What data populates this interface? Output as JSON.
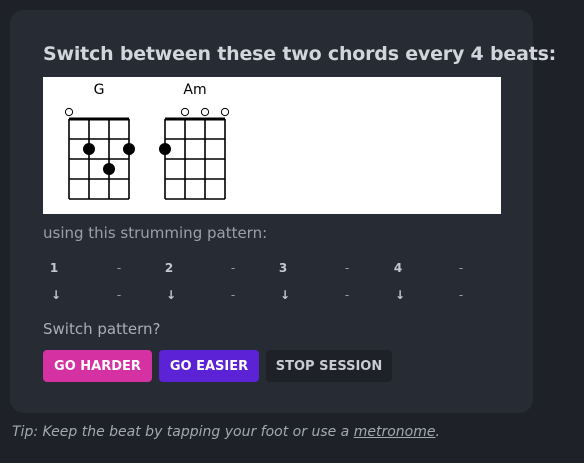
{
  "title": "Switch between these two chords every 4 beats:",
  "chords": [
    {
      "name": "G",
      "strings": [
        "o",
        "",
        "",
        ""
      ]
    },
    {
      "name": "Am",
      "strings": [
        "",
        "o",
        "o",
        "o"
      ]
    }
  ],
  "strumming_label": "using this strumming pattern:",
  "beats": [
    "1",
    "-",
    "2",
    "-",
    "3",
    "-",
    "4",
    "-"
  ],
  "strums": [
    "↓",
    "-",
    "↓",
    "-",
    "↓",
    "-",
    "↓",
    "-"
  ],
  "switch_label": "Switch pattern?",
  "buttons": {
    "harder": "GO HARDER",
    "easier": "GO EASIER",
    "stop": "STOP SESSION"
  },
  "tip": {
    "prefix": "Tip: Keep the beat by tapping your foot or use a ",
    "link": "metronome",
    "suffix": "."
  },
  "colors": {
    "harder": "#d631a3",
    "easier": "#5b22d6",
    "stop": "#1e2128",
    "card": "#272b33",
    "background": "#1e2128"
  }
}
